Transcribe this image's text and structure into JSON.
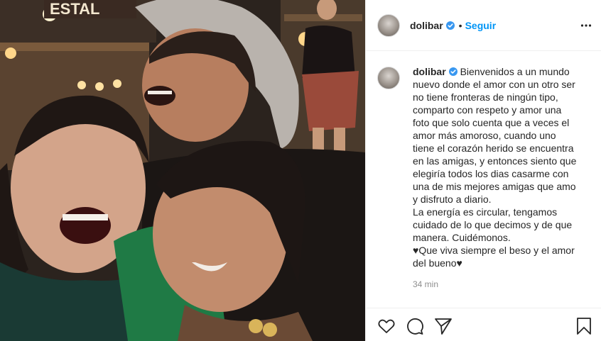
{
  "post": {
    "username": "dolibar",
    "verified": true,
    "separator": "•",
    "follow_label": "Seguir",
    "caption_username": "dolibar",
    "caption_text": "Bienvenidos a un mundo\nnuevo donde el amor con un otro ser\nno tiene fronteras de ningún tipo,\ncomparto con respeto y amor una\nfoto que solo cuenta que a veces el\namor más amoroso, cuando uno\ntiene el corazón herido se encuentra\nen las amigas, y entonces siento que\nelegiría todos los dias casarme con\nuna de mis mejores amigas que amo\ny disfruto a diario.\nLa energía es circular, tengamos\ncuidado de lo que decimos y de que\nmanera. Cuidémonos.\n♥Que viva siempre el beso y el amor\ndel bueno♥",
    "time_ago": "34 min",
    "photo_sign_text": "ESTAL"
  },
  "icons": {
    "verified": "verified-badge-icon",
    "more": "more-options-icon",
    "like": "heart-icon",
    "comment": "comment-icon",
    "share": "share-icon",
    "save": "bookmark-icon"
  },
  "colors": {
    "accent": "#0095f6",
    "text": "#262626",
    "muted": "#8e8e8e",
    "border": "#efefef"
  }
}
